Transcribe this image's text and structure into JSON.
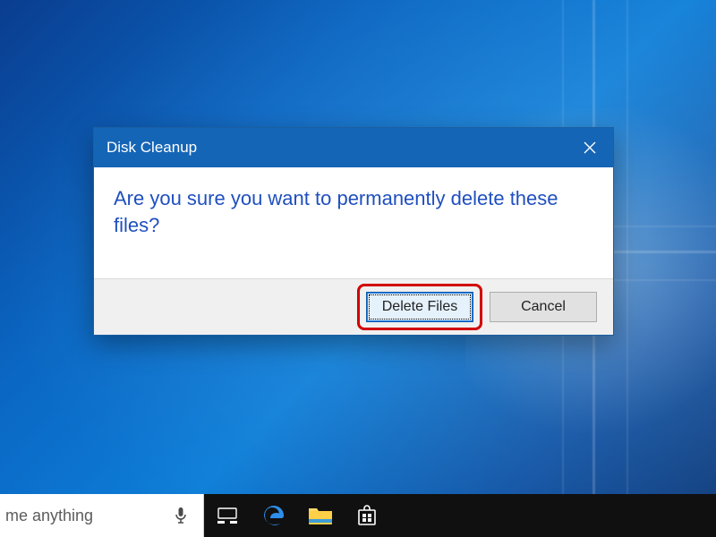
{
  "dialog": {
    "title": "Disk Cleanup",
    "message": "Are you sure you want to permanently delete these files?",
    "buttons": {
      "confirm": "Delete Files",
      "cancel": "Cancel"
    }
  },
  "taskbar": {
    "search_placeholder": "me anything"
  },
  "icons": {
    "close": "close-icon",
    "mic": "microphone-icon",
    "task_view": "task-view-icon",
    "edge": "edge-icon",
    "file_explorer": "file-explorer-icon",
    "store": "store-icon"
  }
}
